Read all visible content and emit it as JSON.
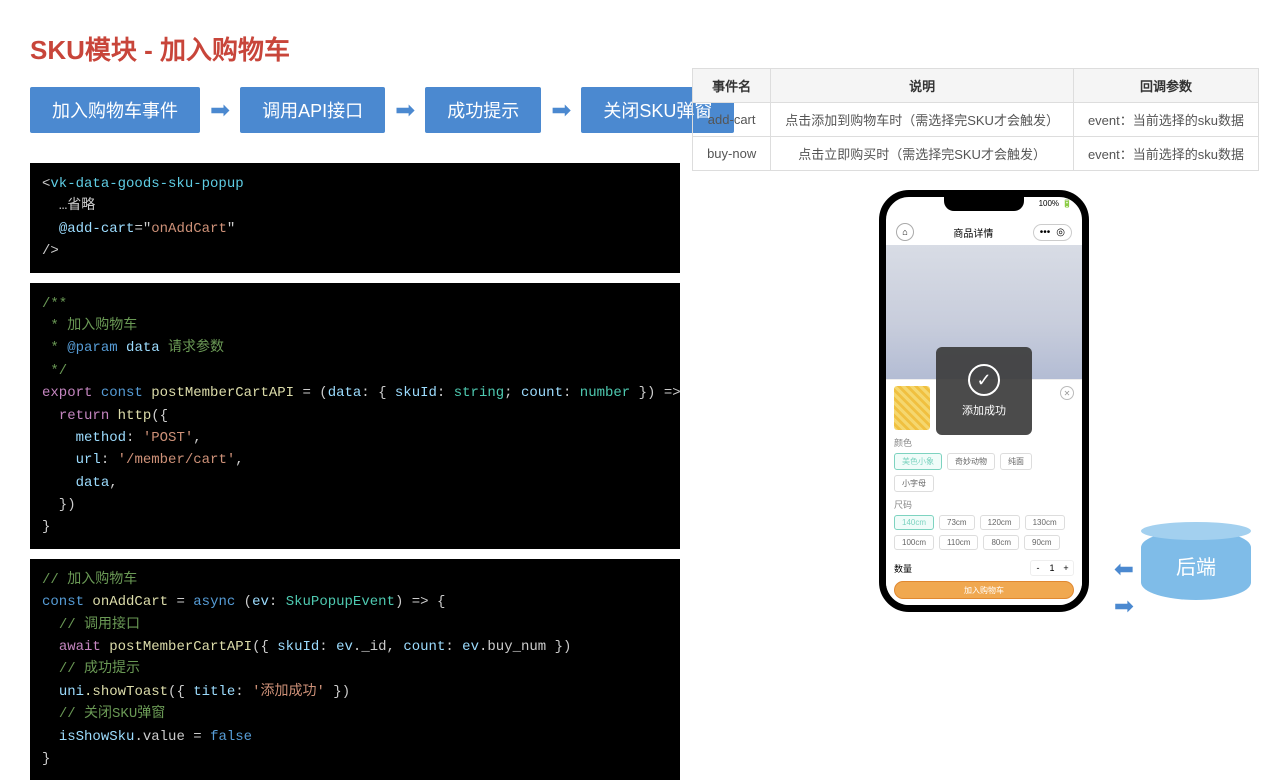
{
  "title": "SKU模块 - 加入购物车",
  "flow": [
    "加入购物车事件",
    "调用API接口",
    "成功提示",
    "关闭SKU弹窗"
  ],
  "table": {
    "headers": [
      "事件名",
      "说明",
      "回调参数"
    ],
    "rows": [
      [
        "add-cart",
        "点击添加到购物车时（需选择完SKU才会触发）",
        "event：当前选择的sku数据"
      ],
      [
        "buy-now",
        "点击立即购买时（需选择完SKU才会触发）",
        "event：当前选择的sku数据"
      ]
    ]
  },
  "code1": {
    "tag": "vk-data-goods-sku-popup",
    "omit": "…省略",
    "event": "@add-cart",
    "handler": "onAddCart"
  },
  "code2": {
    "cmt1": "/**",
    "cmt2": " * 加入购物车",
    "cmt3_pre": " * ",
    "cmt3_tag": "@param",
    "cmt3_param": "data",
    "cmt3_desc": " 请求参数",
    "cmt4": " */",
    "export": "export",
    "const": "const",
    "fn": "postMemberCartAPI",
    "eq": " = (",
    "param": "data",
    "colon": ": { ",
    "p1": "skuId",
    "t1": "string",
    "p2": "count",
    "t2": "number",
    "close": " }) => {",
    "ret": "return",
    "http": "http",
    "method_k": "method",
    "method_v": "'POST'",
    "url_k": "url",
    "url_v": "'/member/cart'",
    "data_k": "data"
  },
  "code3": {
    "cmt1": "// 加入购物车",
    "const": "const",
    "fn": "onAddCart",
    "async": "async",
    "param": "ev",
    "type": "SkuPopupEvent",
    "cmt2": "// 调用接口",
    "await": "await",
    "api": "postMemberCartAPI",
    "args": "({ skuId: ev._id, count: ev.buy_num })",
    "skuId": "skuId",
    "ev_id": "ev",
    "id_prop": "._id",
    "count": "count",
    "buy_num": ".buy_num",
    "cmt3": "// 成功提示",
    "uni": "uni",
    "showToast": ".showToast",
    "title_k": "title",
    "title_v": "'添加成功'",
    "cmt4": "// 关闭SKU弹窗",
    "isShow": "isShowSku",
    "value": ".value",
    "false": "false"
  },
  "phone": {
    "battery": "100%",
    "home_icon": "⌂",
    "title": "商品详情",
    "dots": "•••",
    "target": "◎",
    "toast": "添加成功",
    "close": "✕",
    "check": "✓",
    "color_label": "颜色",
    "colors": [
      "美色小象",
      "奇妙动物",
      "纯面",
      "小字母"
    ],
    "size_label": "尺码",
    "sizes_row1": [
      "140cm",
      "73cm",
      "120cm",
      "130cm"
    ],
    "sizes_row2": [
      "100cm",
      "110cm",
      "80cm",
      "90cm"
    ],
    "qty_label": "数量",
    "minus": "-",
    "qty_val": "1",
    "plus": "+",
    "add_btn": "加入购物车"
  },
  "backend": "后端"
}
